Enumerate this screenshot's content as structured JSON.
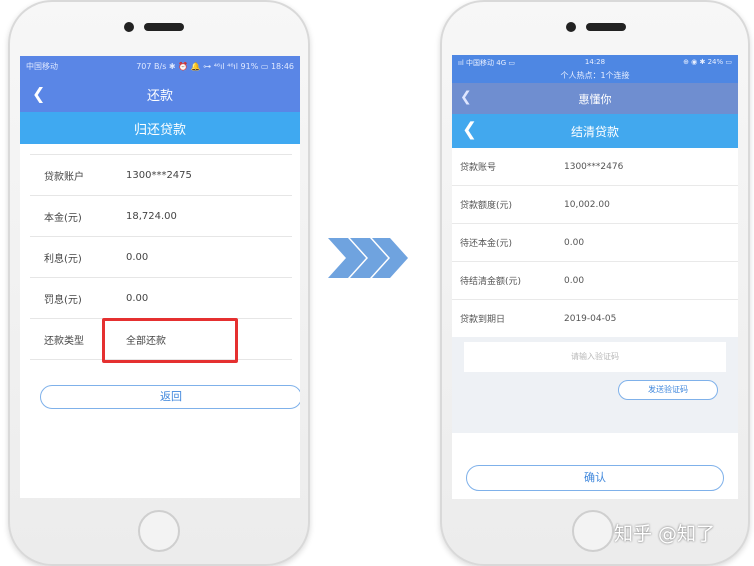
{
  "left_phone": {
    "status_bar": {
      "carrier": "中国移动",
      "right": "707 B/s ✱ ⏰ 🔔 ⊶ ⁴⁶ıl ⁴⁶ıl 91% ▭ 18:46"
    },
    "title": "还款",
    "subtitle": "归还贷款",
    "rows": [
      {
        "label": "贷款账户",
        "value": "1300***2475"
      },
      {
        "label": "本金(元)",
        "value": "18,724.00"
      },
      {
        "label": "利息(元)",
        "value": "0.00"
      },
      {
        "label": "罚息(元)",
        "value": "0.00"
      },
      {
        "label": "还款类型",
        "value": "全部还款"
      }
    ],
    "return_button": "返回",
    "highlight_color": "#e53030"
  },
  "right_phone": {
    "status_bar": {
      "left": "ııl 中国移动  4G  ▭",
      "time": "14:28",
      "right": "⊕ ◉ ✱ 24% ▭",
      "hotspot": "个人热点：1个连接"
    },
    "app_title": "惠懂你",
    "subtitle": "结清贷款",
    "rows": [
      {
        "label": "贷款账号",
        "value": "1300***2476"
      },
      {
        "label": "贷款额度(元)",
        "value": "10,002.00"
      },
      {
        "label": "待还本金(元)",
        "value": "0.00"
      },
      {
        "label": "待结清金额(元)",
        "value": "0.00"
      },
      {
        "label": "贷款到期日",
        "value": "2019-04-05"
      }
    ],
    "code_placeholder": "请输入验证码",
    "send_code_button": "发送验证码",
    "confirm_button": "确认"
  },
  "arrow_icon": "triple-chevron-right-icon",
  "accent_color": "#5a86e6",
  "watermark": "知乎 @知了"
}
